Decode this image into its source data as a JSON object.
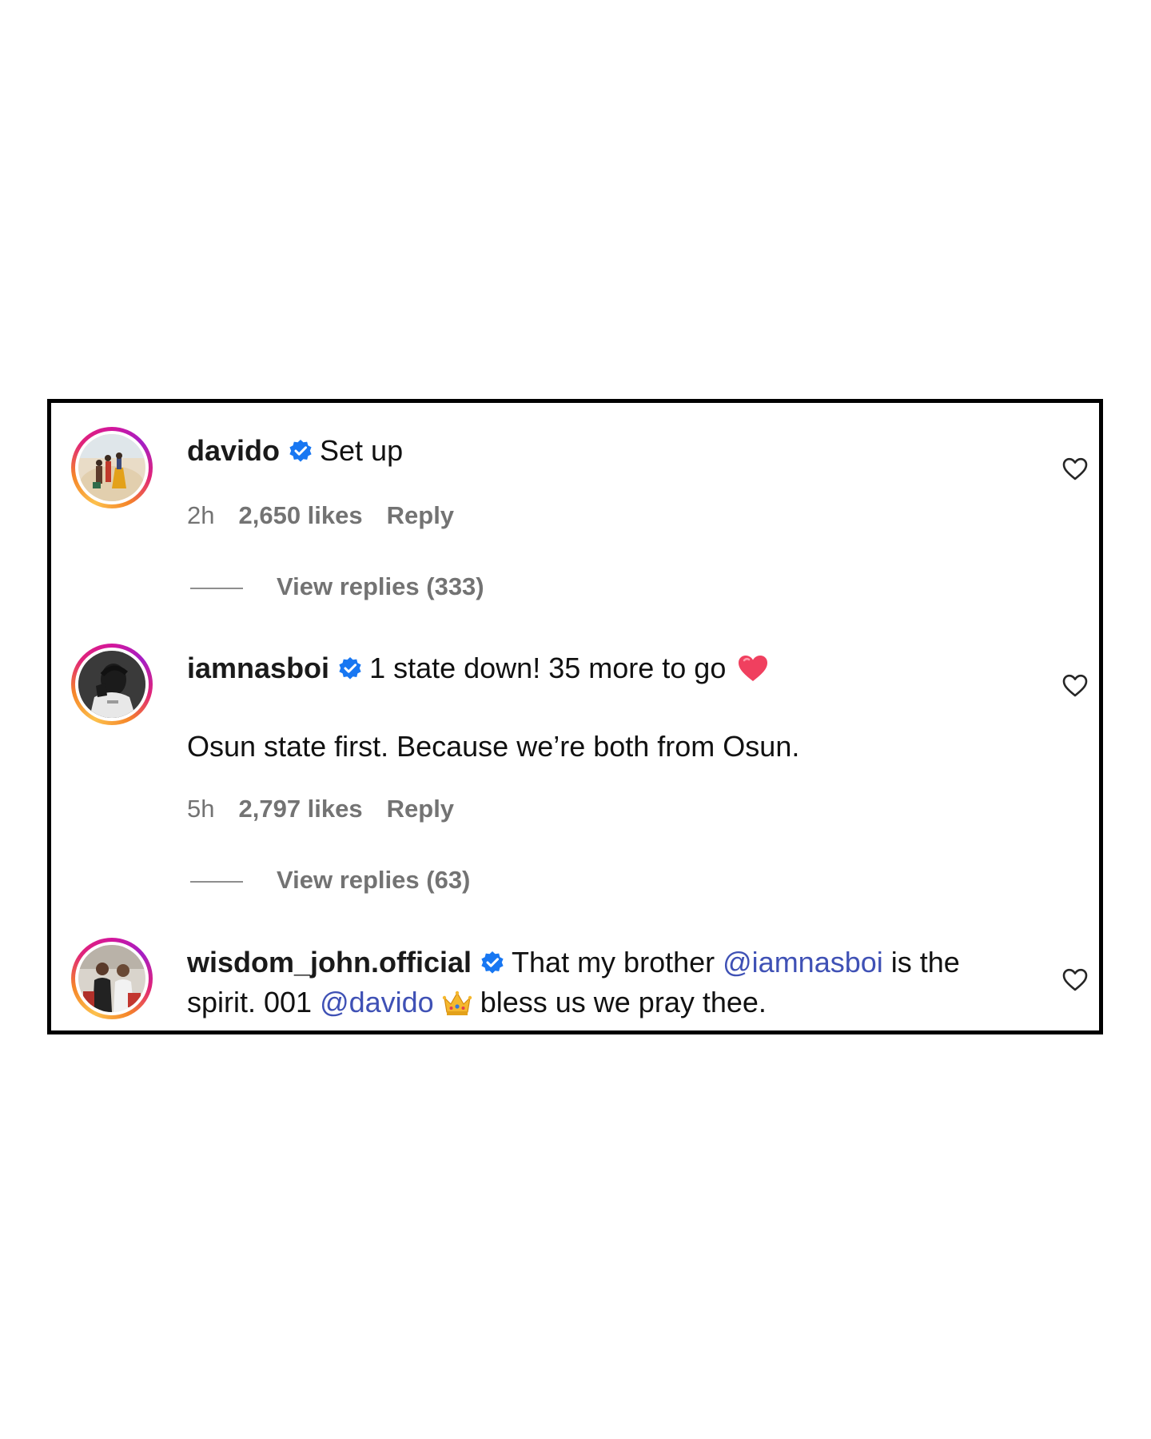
{
  "comments": [
    {
      "username": "davido",
      "text": "Set up",
      "time": "2h",
      "likes": "2,650 likes",
      "reply": "Reply",
      "view_replies": "View replies (333)",
      "avatar": "desert-scene-avatar"
    },
    {
      "username": "iamnasboi",
      "text": "1 state down! 35 more to go",
      "emoji": "red-heart-emoji",
      "text2": "Osun state first. Because we’re both from Osun.",
      "time": "5h",
      "likes": "2,797 likes",
      "reply": "Reply",
      "view_replies": "View replies (63)",
      "avatar": "portrait-avatar"
    },
    {
      "username": "wisdom_john.official",
      "text_a": "That my brother ",
      "mention_a": "@iamnasboi",
      "text_b": " is the",
      "text_c": "spirit. 001 ",
      "mention_b": "@davido",
      "emoji": "crown-emoji",
      "text_d": "bless us we pray thee.",
      "avatar": "group-photo-avatar"
    }
  ],
  "icons": {
    "verified": "verified-badge-icon",
    "like": "heart-outline-icon"
  },
  "colors": {
    "verified_blue": "#1877f2",
    "mention": "#3f51b5",
    "meta_gray": "#737373",
    "border": "#000000"
  }
}
